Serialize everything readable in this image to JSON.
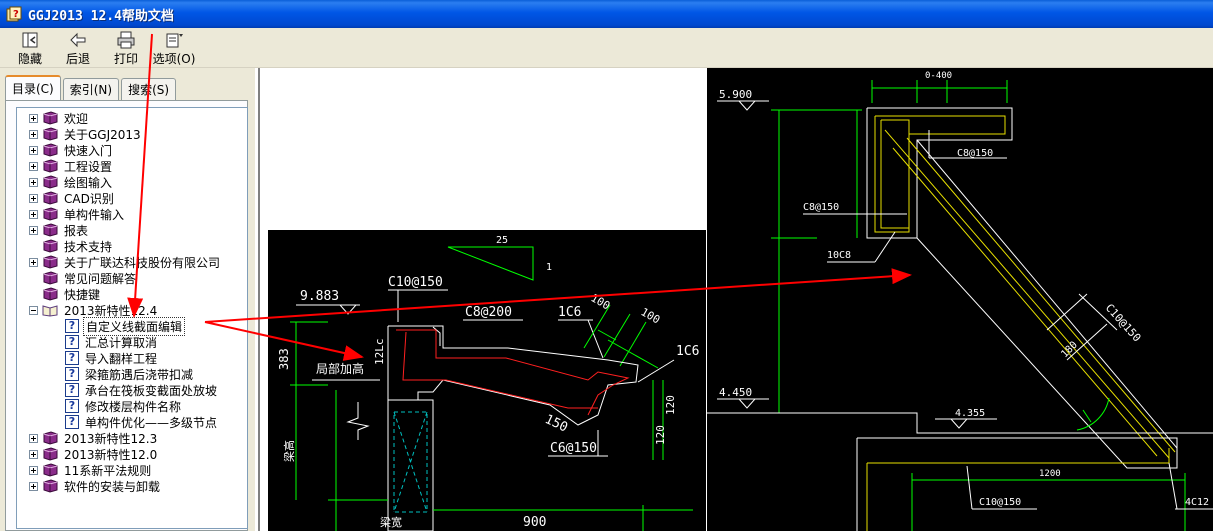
{
  "window": {
    "title": "GGJ2013 12.4帮助文档"
  },
  "toolbar": {
    "buttons": [
      {
        "label": "隐藏",
        "icon": "hide-icon"
      },
      {
        "label": "后退",
        "icon": "back-arrow-icon"
      },
      {
        "label": "打印",
        "icon": "printer-icon"
      },
      {
        "label": "选项(O)",
        "icon": "options-icon"
      }
    ]
  },
  "tabs": {
    "contents": "目录(C)",
    "index": "索引(N)",
    "search": "搜索(S)"
  },
  "tree": {
    "items": [
      {
        "label": "欢迎",
        "expander": "plus",
        "icon": "book-icon"
      },
      {
        "label": "关于GGJ2013",
        "expander": "plus",
        "icon": "book-icon"
      },
      {
        "label": "快速入门",
        "expander": "plus",
        "icon": "book-icon"
      },
      {
        "label": "工程设置",
        "expander": "plus",
        "icon": "book-icon"
      },
      {
        "label": "绘图输入",
        "expander": "plus",
        "icon": "book-icon"
      },
      {
        "label": "CAD识别",
        "expander": "plus",
        "icon": "book-icon"
      },
      {
        "label": "单构件输入",
        "expander": "plus",
        "icon": "book-icon"
      },
      {
        "label": "报表",
        "expander": "plus",
        "icon": "book-icon"
      },
      {
        "label": "技术支持",
        "expander": "none",
        "icon": "book-icon"
      },
      {
        "label": "关于广联达科技股份有限公司",
        "expander": "plus",
        "icon": "book-icon"
      },
      {
        "label": "常见问题解答",
        "expander": "none",
        "icon": "book-icon"
      },
      {
        "label": "快捷键",
        "expander": "none",
        "icon": "book-icon"
      },
      {
        "label": "2013新特性12.4",
        "expander": "minus",
        "icon": "open-book-icon"
      },
      {
        "label": "自定义线截面编辑",
        "expander": "none",
        "icon": "help-page-icon",
        "child": true,
        "selected": true
      },
      {
        "label": "汇总计算取消",
        "expander": "none",
        "icon": "help-page-icon",
        "child": true
      },
      {
        "label": "导入翻样工程",
        "expander": "none",
        "icon": "help-page-icon",
        "child": true
      },
      {
        "label": "梁箍筋遇后浇带扣减",
        "expander": "none",
        "icon": "help-page-icon",
        "child": true
      },
      {
        "label": "承台在筏板变截面处放坡",
        "expander": "none",
        "icon": "help-page-icon",
        "child": true
      },
      {
        "label": "修改楼层构件名称",
        "expander": "none",
        "icon": "help-page-icon",
        "child": true
      },
      {
        "label": "单构件优化——多级节点",
        "expander": "none",
        "icon": "help-page-icon",
        "child": true
      },
      {
        "label": "2013新特性12.3",
        "expander": "plus",
        "icon": "book-icon"
      },
      {
        "label": "2013新特性12.0",
        "expander": "plus",
        "icon": "book-icon"
      },
      {
        "label": "11系新平法规则",
        "expander": "plus",
        "icon": "book-icon"
      },
      {
        "label": "软件的安装与卸载",
        "expander": "plus",
        "icon": "book-icon"
      }
    ]
  },
  "drawing_left": {
    "slope_run": "25",
    "slope_rise": "1",
    "elevation": "9.883",
    "rebar_top": "C10@150",
    "rebar_mid": "C8@200",
    "rebar_1c6_a": "1C6",
    "dim_100_a": "100",
    "dim_100_b": "100",
    "rebar_1c6_b": "1C6",
    "vertical_label": "12Lc",
    "local_thicken": "局部加高",
    "dim_383": "383",
    "dim_120_a": "120",
    "dim_120_b": "120",
    "dim_150": "150",
    "rebar_bottom": "C6@150",
    "beam_height": "梁高",
    "beam_width": "梁宽",
    "dim_900": "900"
  },
  "drawing_right": {
    "dim_top": "0-400",
    "elevation_top": "5.900",
    "rebar_c8_a": "C8@150",
    "rebar_c8_b": "C8@150",
    "rebar_10c8": "10C8",
    "rebar_c10_diag": "C10@150",
    "diag_dim": "180",
    "elevation_left": "4.450",
    "elevation_mid": "4.355",
    "dim_1200": "1200",
    "rebar_c10_bottom": "C10@150",
    "rebar_4c12": "4C12"
  },
  "colors": {
    "title_bar": "#0054e3",
    "cad_background": "#000000",
    "cad_green": "#00ff00",
    "cad_white": "#ffffff",
    "cad_yellow": "#e8e000",
    "cad_red": "#ff2020",
    "annotation_arrow": "#ff0000"
  }
}
